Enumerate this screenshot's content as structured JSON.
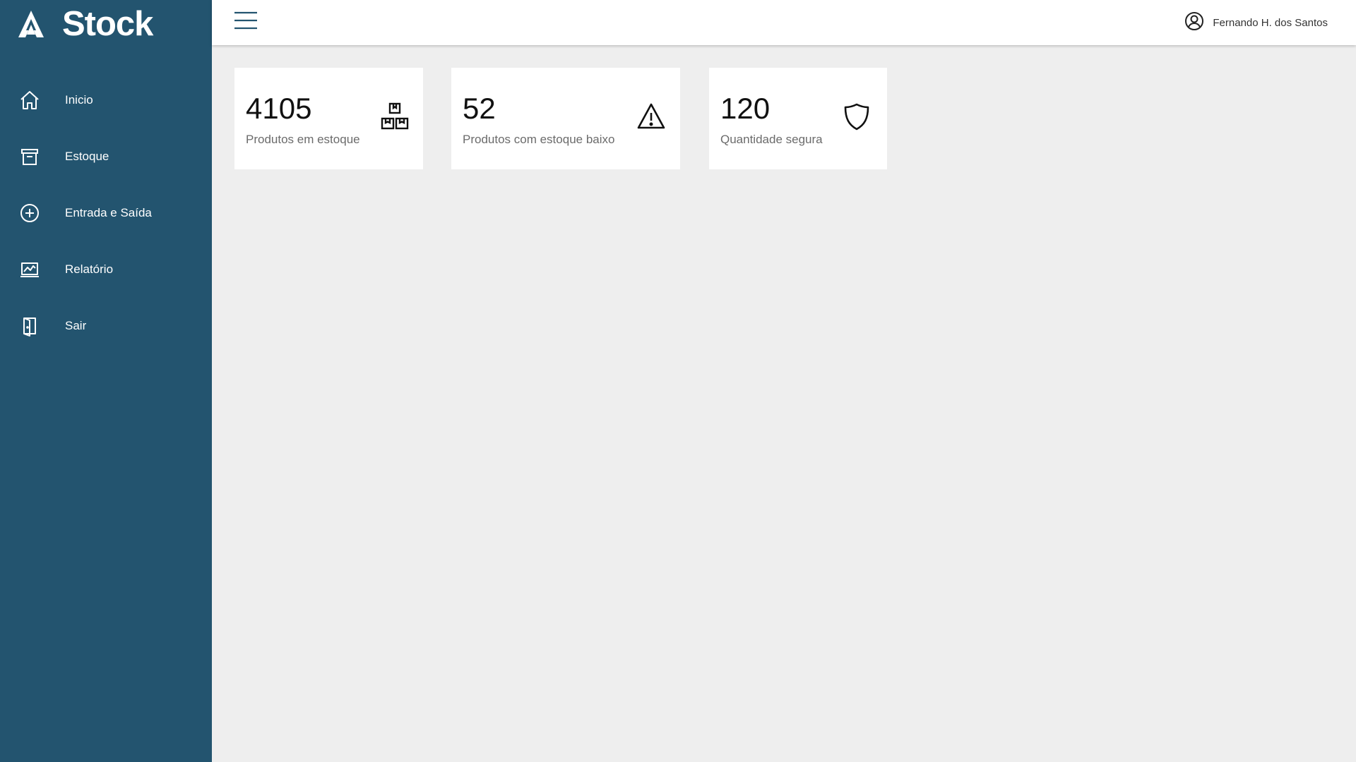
{
  "app": {
    "name": "Stock",
    "icon": "logo-icon"
  },
  "sidebar": {
    "items": [
      {
        "label": "Inicio",
        "icon": "home-icon"
      },
      {
        "label": "Estoque",
        "icon": "archive-box-icon"
      },
      {
        "label": "Entrada e Saída",
        "icon": "plus-circle-icon"
      },
      {
        "label": "Relatório",
        "icon": "chart-report-icon"
      },
      {
        "label": "Sair",
        "icon": "door-exit-icon"
      }
    ]
  },
  "topbar": {
    "menu_icon": "hamburger-menu-icon",
    "user": {
      "name": "Fernando H. dos Santos",
      "icon": "user-circle-icon"
    }
  },
  "cards": [
    {
      "value": "4105",
      "label": "Produtos em estoque",
      "icon": "boxes-icon"
    },
    {
      "value": "52",
      "label": "Produtos com estoque baixo",
      "icon": "warning-triangle-icon"
    },
    {
      "value": "120",
      "label": "Quantidade segura",
      "icon": "shield-icon"
    }
  ],
  "colors": {
    "sidebar_bg": "#23546f",
    "content_bg": "#eeeeee",
    "card_bg": "#ffffff",
    "accent": "#23546f"
  }
}
